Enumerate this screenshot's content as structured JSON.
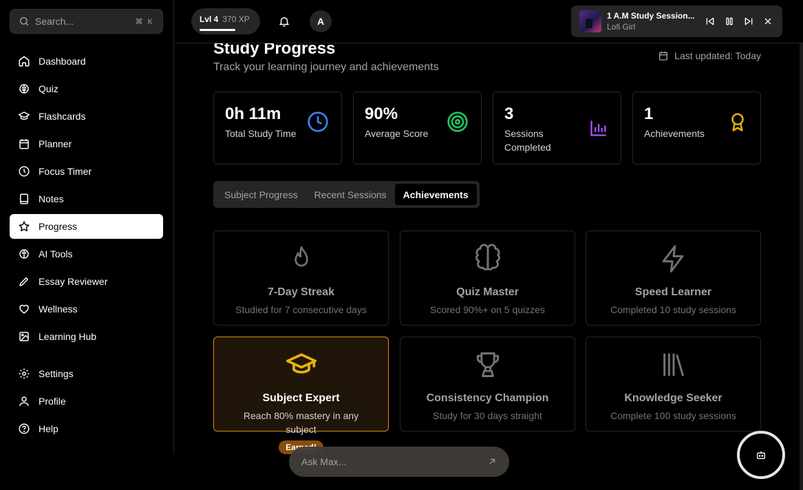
{
  "search": {
    "placeholder": "Search...",
    "shortcut": "⌘ K"
  },
  "sidebar": {
    "items": [
      {
        "label": "Dashboard",
        "icon": "home-icon"
      },
      {
        "label": "Quiz",
        "icon": "brain-icon"
      },
      {
        "label": "Flashcards",
        "icon": "graduation-cap-icon"
      },
      {
        "label": "Planner",
        "icon": "calendar-icon"
      },
      {
        "label": "Focus Timer",
        "icon": "clock-icon"
      },
      {
        "label": "Notes",
        "icon": "notebook-icon"
      },
      {
        "label": "Progress",
        "icon": "star-icon",
        "active": true
      },
      {
        "label": "AI Tools",
        "icon": "brain-icon"
      },
      {
        "label": "Essay Reviewer",
        "icon": "pen-icon"
      },
      {
        "label": "Wellness",
        "icon": "heart-icon"
      },
      {
        "label": "Learning Hub",
        "icon": "image-icon"
      }
    ],
    "bottom_items": [
      {
        "label": "Settings",
        "icon": "gear-icon"
      },
      {
        "label": "Profile",
        "icon": "user-icon"
      },
      {
        "label": "Help",
        "icon": "help-icon"
      }
    ]
  },
  "header": {
    "level": "Lvl 4",
    "xp": "370 XP",
    "avatar_initial": "A"
  },
  "player": {
    "title": "1 A.M Study Session...",
    "artist": "Lofi Girl"
  },
  "page": {
    "title": "Study Progress",
    "subtitle": "Track your learning journey and achievements",
    "updated": "Last updated: Today"
  },
  "stats": [
    {
      "value": "0h 11m",
      "label": "Total Study Time",
      "icon": "clock-icon",
      "color": "#3b82f6"
    },
    {
      "value": "90%",
      "label": "Average Score",
      "icon": "target-icon",
      "color": "#22c55e"
    },
    {
      "value": "3",
      "label": "Sessions Completed",
      "icon": "bar-chart-icon",
      "color": "#a855f7"
    },
    {
      "value": "1",
      "label": "Achievements",
      "icon": "award-icon",
      "color": "#eab308"
    }
  ],
  "tabs": [
    {
      "label": "Subject Progress"
    },
    {
      "label": "Recent Sessions"
    },
    {
      "label": "Achievements",
      "active": true
    }
  ],
  "achievements": [
    {
      "title": "7-Day Streak",
      "desc": "Studied for 7 consecutive days",
      "icon": "flame-icon"
    },
    {
      "title": "Quiz Master",
      "desc": "Scored 90%+ on 5 quizzes",
      "icon": "brain-icon"
    },
    {
      "title": "Speed Learner",
      "desc": "Completed 10 study sessions",
      "icon": "lightning-icon"
    },
    {
      "title": "Subject Expert",
      "desc": "Reach 80% mastery in any subject",
      "icon": "graduation-cap-icon",
      "earned": true,
      "badge": "Earned!"
    },
    {
      "title": "Consistency Champion",
      "desc": "Study for 30 days straight",
      "icon": "trophy-icon"
    },
    {
      "title": "Knowledge Seeker",
      "desc": "Complete 100 study sessions",
      "icon": "library-icon"
    }
  ],
  "ask_max": {
    "placeholder": "Ask Max..."
  },
  "colors": {
    "accent_earned": "#d98a1b",
    "earned_icon": "#eab308"
  }
}
